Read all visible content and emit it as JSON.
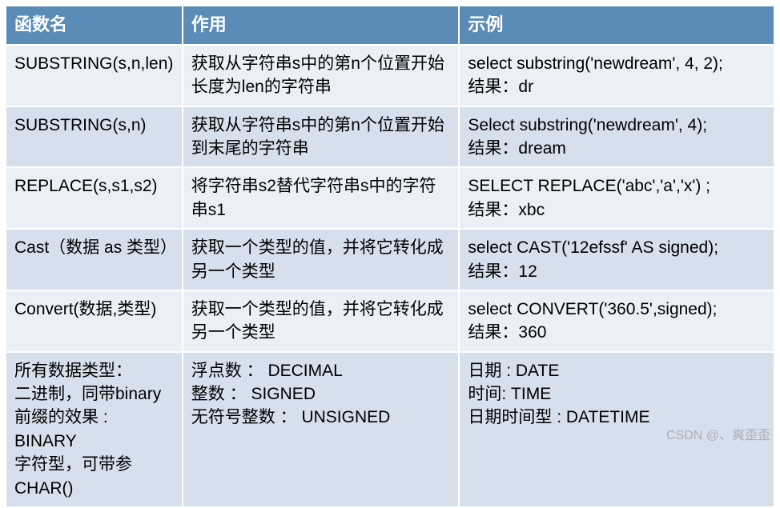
{
  "table": {
    "headers": [
      "函数名",
      "作用",
      "示例"
    ],
    "rows": [
      {
        "name": "SUBSTRING(s,n,len)",
        "desc": "获取从字符串s中的第n个位置开始长度为len的字符串",
        "example": "select substring('newdream', 4, 2);\n结果：dr"
      },
      {
        "name": "SUBSTRING(s,n)",
        "desc": "获取从字符串s中的第n个位置开始到末尾的字符串",
        "example": "Select substring('newdream', 4);\n结果：dream"
      },
      {
        "name": "REPLACE(s,s1,s2)",
        "desc": "将字符串s2替代字符串s中的字符串s1",
        "example": "SELECT REPLACE('abc','a','x') ;\n结果：xbc"
      },
      {
        "name": "Cast（数据 as 类型）",
        "desc": "获取一个类型的值，并将它转化成另一个类型",
        "example": "select  CAST('12efssf' AS signed);\n结果：12"
      },
      {
        "name": "Convert(数据,类型)",
        "desc": "获取一个类型的值，并将它转化成另一个类型",
        "example": "select CONVERT('360.5',signed);\n结果：360"
      },
      {
        "name": "所有数据类型：\n二进制，同带binary前缀的效果 : BINARY\n 字符型，可带参CHAR()",
        "desc": "浮点数 ： DECIMAL\n整数 ： SIGNED\n无符号整数 ： UNSIGNED",
        "example": "日期 : DATE\n时间: TIME\n日期时间型 : DATETIME"
      }
    ]
  },
  "watermark": "CSDN @、爽歪歪"
}
